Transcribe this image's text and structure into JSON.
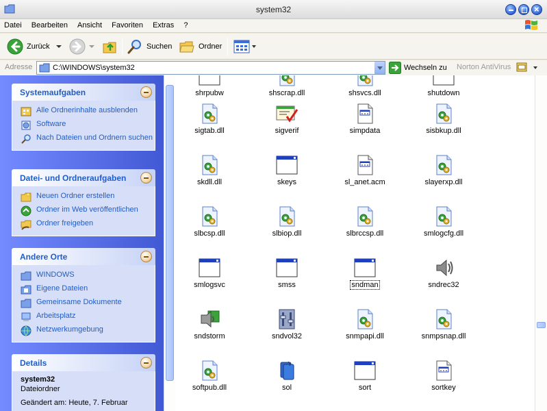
{
  "window": {
    "title": "system32"
  },
  "menu": [
    "Datei",
    "Bearbeiten",
    "Ansicht",
    "Favoriten",
    "Extras",
    "?"
  ],
  "toolbar": {
    "back": "Zurück",
    "search": "Suchen",
    "folders": "Ordner"
  },
  "address": {
    "label": "Adresse",
    "value": "C:\\WINDOWS\\system32",
    "go": "Wechseln zu",
    "antivirus": "Norton AntiVirus"
  },
  "panels": {
    "system": {
      "title": "Systemaufgaben",
      "items": [
        "Alle Ordnerinhalte ausblenden",
        "Software",
        "Nach Dateien und Ordnern suchen"
      ]
    },
    "filetasks": {
      "title": "Datei- und Ordneraufgaben",
      "items": [
        "Neuen Ordner erstellen",
        "Ordner im Web veröffentlichen",
        "Ordner freigeben"
      ]
    },
    "places": {
      "title": "Andere Orte",
      "items": [
        "WINDOWS",
        "Eigene Dateien",
        "Gemeinsame Dokumente",
        "Arbeitsplatz",
        "Netzwerkumgebung"
      ]
    },
    "details": {
      "title": "Details",
      "name": "system32",
      "type": "Dateiordner",
      "modified": "Geändert am: Heute, 7. Februar"
    }
  },
  "files": [
    {
      "name": "shrpubw",
      "icon": "app-window-icon"
    },
    {
      "name": "shscrap.dll",
      "icon": "dll-gear-icon"
    },
    {
      "name": "shsvcs.dll",
      "icon": "dll-gear-icon"
    },
    {
      "name": "shutdown",
      "icon": "app-window-icon"
    },
    {
      "name": "sigtab.dll",
      "icon": "dll-gear-icon"
    },
    {
      "name": "sigverif",
      "icon": "sigverif-icon"
    },
    {
      "name": "simpdata",
      "icon": "document-icon"
    },
    {
      "name": "sisbkup.dll",
      "icon": "dll-gear-icon"
    },
    {
      "name": "skdll.dll",
      "icon": "dll-gear-icon"
    },
    {
      "name": "skeys",
      "icon": "app-window-icon"
    },
    {
      "name": "sl_anet.acm",
      "icon": "document-icon"
    },
    {
      "name": "slayerxp.dll",
      "icon": "dll-gear-icon"
    },
    {
      "name": "slbcsp.dll",
      "icon": "dll-gear-icon"
    },
    {
      "name": "slbiop.dll",
      "icon": "dll-gear-icon"
    },
    {
      "name": "slbrccsp.dll",
      "icon": "dll-gear-icon"
    },
    {
      "name": "smlogcfg.dll",
      "icon": "dll-gear-icon"
    },
    {
      "name": "smlogsvc",
      "icon": "app-window-icon"
    },
    {
      "name": "smss",
      "icon": "app-window-icon"
    },
    {
      "name": "sndman",
      "icon": "app-window-icon",
      "selected": true
    },
    {
      "name": "sndrec32",
      "icon": "speaker-icon"
    },
    {
      "name": "sndstorm",
      "icon": "sndstorm-icon"
    },
    {
      "name": "sndvol32",
      "icon": "volume-control-icon"
    },
    {
      "name": "snmpapi.dll",
      "icon": "dll-gear-icon"
    },
    {
      "name": "snmpsnap.dll",
      "icon": "dll-gear-icon"
    },
    {
      "name": "softpub.dll",
      "icon": "dll-gear-icon"
    },
    {
      "name": "sol",
      "icon": "solitaire-icon"
    },
    {
      "name": "sort",
      "icon": "app-window-icon"
    },
    {
      "name": "sortkey",
      "icon": "document-icon"
    }
  ]
}
